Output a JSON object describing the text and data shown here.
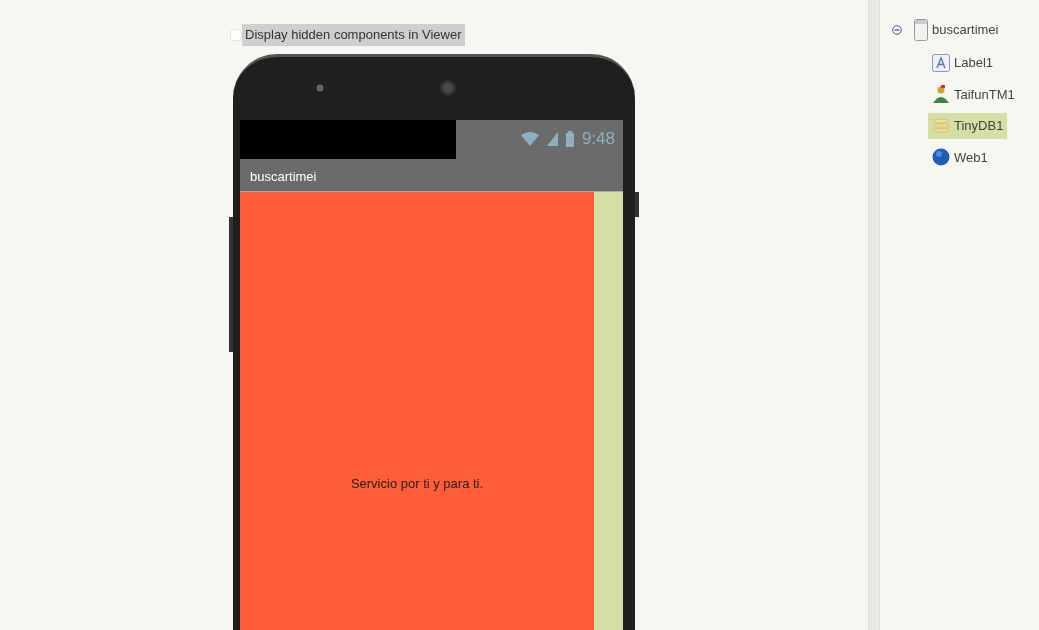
{
  "viewer_option": {
    "label": "Display hidden components in Viewer",
    "checked": false
  },
  "phone": {
    "status_time": "9:48",
    "app_title": "buscartimei",
    "label_text": "Servicio por ti y para ti."
  },
  "components": [
    {
      "name": "buscartimei",
      "kind": "screen",
      "expanded": true,
      "selected": false,
      "children": [
        {
          "name": "Label1",
          "kind": "label",
          "selected": false
        },
        {
          "name": "TaifunTM1",
          "kind": "extension",
          "selected": false
        },
        {
          "name": "TinyDB1",
          "kind": "database",
          "selected": true
        },
        {
          "name": "Web1",
          "kind": "web",
          "selected": false
        }
      ]
    }
  ]
}
